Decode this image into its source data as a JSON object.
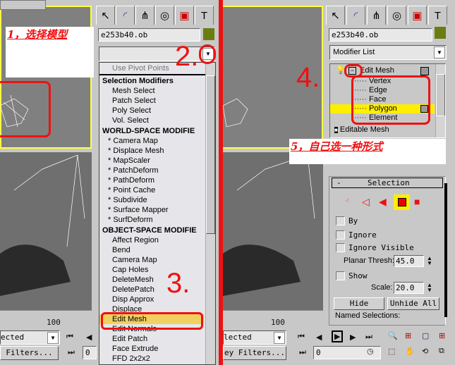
{
  "left": {
    "object_name": "e253b40.ob",
    "modifier_dropdown_value": "",
    "list_items": [
      {
        "label": "Use Pivot Points",
        "type": "top"
      },
      {
        "label": "Selection Modifiers",
        "type": "header"
      },
      {
        "label": "Mesh Select",
        "type": "item"
      },
      {
        "label": "Patch Select",
        "type": "item"
      },
      {
        "label": "Poly Select",
        "type": "item"
      },
      {
        "label": "Vol. Select",
        "type": "item"
      },
      {
        "label": "WORLD-SPACE MODIFIE",
        "type": "header"
      },
      {
        "label": "* Camera Map",
        "type": "star"
      },
      {
        "label": "* Displace Mesh",
        "type": "star"
      },
      {
        "label": "* MapScaler",
        "type": "star"
      },
      {
        "label": "* PatchDeform",
        "type": "star"
      },
      {
        "label": "* PathDeform",
        "type": "star"
      },
      {
        "label": "* Point Cache",
        "type": "star"
      },
      {
        "label": "* Subdivide",
        "type": "star"
      },
      {
        "label": "* Surface Mapper",
        "type": "star"
      },
      {
        "label": "* SurfDeform",
        "type": "star"
      },
      {
        "label": "OBJECT-SPACE MODIFIE",
        "type": "header"
      },
      {
        "label": "Affect Region",
        "type": "item"
      },
      {
        "label": "Bend",
        "type": "item"
      },
      {
        "label": "Camera Map",
        "type": "item"
      },
      {
        "label": "Cap Holes",
        "type": "item"
      },
      {
        "label": "DeleteMesh",
        "type": "item"
      },
      {
        "label": "DeletePatch",
        "type": "item"
      },
      {
        "label": "Disp Approx",
        "type": "item"
      },
      {
        "label": "Displace",
        "type": "item"
      },
      {
        "label": "Edit Mesh",
        "type": "selected"
      },
      {
        "label": "Edit Normals",
        "type": "item"
      },
      {
        "label": "Edit Patch",
        "type": "item"
      },
      {
        "label": "Face Extrude",
        "type": "item"
      },
      {
        "label": "FFD 2x2x2",
        "type": "item"
      }
    ],
    "timeline_end": "100",
    "selection_dropdown": "ected",
    "filters_button": "Filters...",
    "frame_field": "0"
  },
  "right": {
    "object_name": "e253b40.ob",
    "modifier_list": "Modifier List",
    "stack": {
      "modifier": "Edit Mesh",
      "subobjects": [
        "Vertex",
        "Edge",
        "Face",
        "Polygon",
        "Element"
      ],
      "selected": "Polygon",
      "base": "Editable Mesh"
    },
    "rollout": {
      "title": "Selection",
      "collapse": "-",
      "checkbox_by": "By",
      "checkbox_ignore": "Ignore",
      "checkbox_ignore_visible": "Ignore Visible",
      "planar_thresh_label": "Planar Thresh:",
      "planar_thresh_value": "45.0",
      "checkbox_show": "Show",
      "scale_label": "Scale:",
      "scale_value": "20.0",
      "hide_button": "Hide",
      "unhide_all_button": "Unhide All",
      "named_selections": "Named Selections:"
    },
    "timeline_end": "100",
    "selection_dropdown": "lected",
    "filters_button": "ey Filters...",
    "frame_field": "0"
  },
  "annotations": {
    "step1": "1，选择模型",
    "step2": "2.",
    "step3": "3.",
    "step4": "4.",
    "step5": "5，自己选一种形式"
  },
  "colors": {
    "annotation": "#ee1111",
    "selected_highlight": "#ffee00",
    "object_color": "#6b7d10",
    "viewport_border": "#ffff44"
  }
}
